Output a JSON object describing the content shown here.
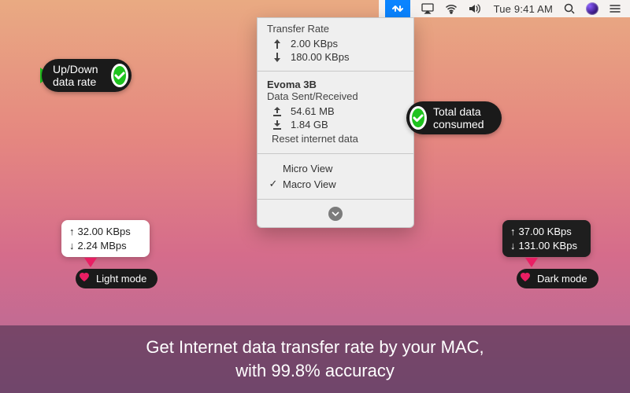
{
  "menubar": {
    "time": "Tue 9:41 AM"
  },
  "dropdown": {
    "transfer_title": "Transfer Rate",
    "up_rate": "2.00 KBps",
    "down_rate": "180.00 KBps",
    "network_name": "Evoma 3B",
    "data_title": "Data Sent/Received",
    "sent": "54.61 MB",
    "received": "1.84 GB",
    "reset": "Reset internet data",
    "view_micro": "Micro View",
    "view_macro": "Macro View"
  },
  "callouts": {
    "updown": "Up/Down data rate",
    "total": "Total data consumed",
    "light_mode": "Light mode",
    "dark_mode": "Dark mode"
  },
  "widgets": {
    "light": {
      "up": "32.00 KBps",
      "down": "2.24 MBps"
    },
    "dark": {
      "up": "37.00 KBps",
      "down": "131.00 KBps"
    }
  },
  "caption": {
    "line1": "Get Internet data transfer rate by your MAC,",
    "line2": "with 99.8% accuracy"
  }
}
